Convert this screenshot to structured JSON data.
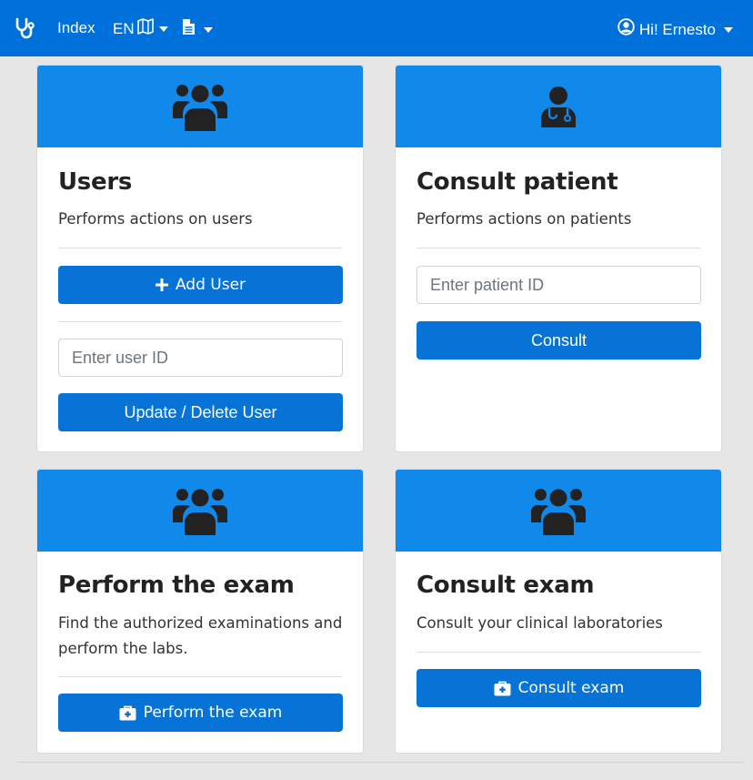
{
  "navbar": {
    "brand_icon": "stethoscope-icon",
    "index_label": "Index",
    "language_label": "EN",
    "language_icon": "map-icon",
    "document_icon": "file-text-icon",
    "user_greeting": "Hi! Ernesto",
    "user_icon": "user-circle-icon",
    "background_color": "#0070db"
  },
  "cards": {
    "users": {
      "header_icon": "users-icon",
      "title": "Users",
      "description": "Performs actions on users",
      "add_button_label": "Add User",
      "add_button_icon": "plus-icon",
      "user_id_placeholder": "Enter user ID",
      "update_delete_button_label": "Update / Delete User"
    },
    "consult_patient": {
      "header_icon": "user-doctor-icon",
      "title": "Consult patient",
      "description": "Performs actions on patients",
      "patient_id_placeholder": "Enter patient ID",
      "consult_button_label": "Consult"
    },
    "perform_exam": {
      "header_icon": "users-icon",
      "title": "Perform the exam",
      "description_line1": "Find the authorized examinations and",
      "description_line2": "perform the labs.",
      "button_label": "Perform the exam",
      "button_icon": "medkit-icon"
    },
    "consult_exam": {
      "header_icon": "users-icon",
      "title": "Consult exam",
      "description": "Consult your clinical laboratories",
      "button_label": "Consult exam",
      "button_icon": "medkit-icon"
    }
  },
  "colors": {
    "card_header": "#1089eb",
    "button": "#0773d6",
    "page_background": "#e6e6e6"
  }
}
